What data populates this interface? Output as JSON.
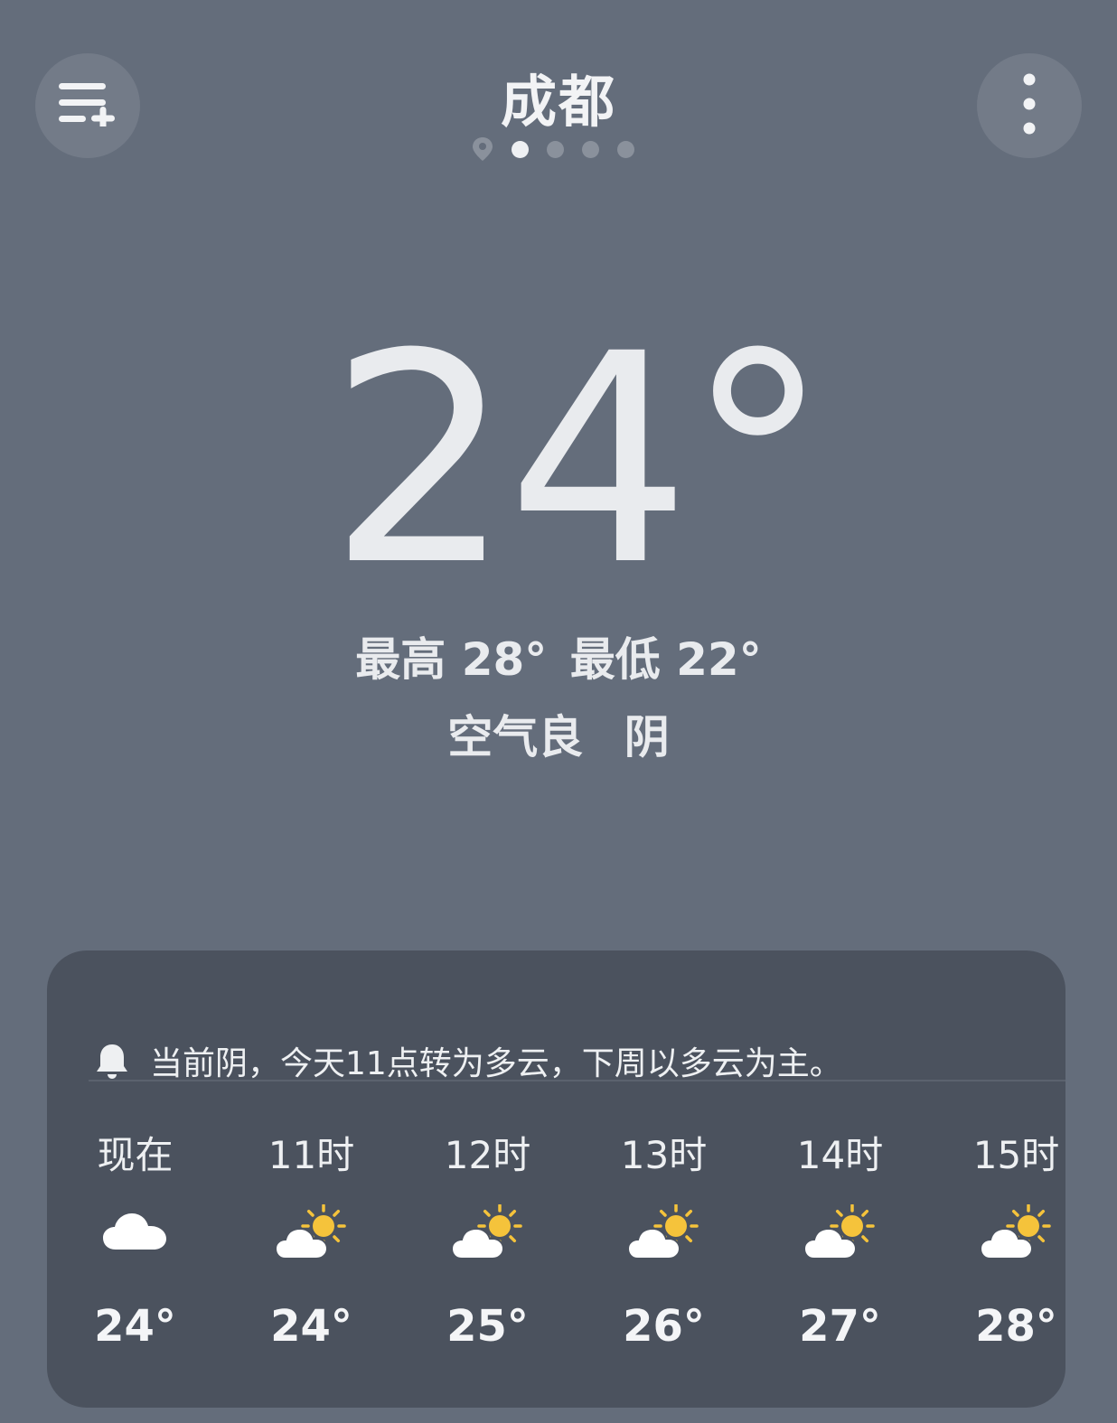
{
  "header": {
    "city": "成都",
    "menu_icon": "list-add-icon",
    "more_icon": "more-vertical-icon",
    "location_icon": "location-pin-icon",
    "page_dots": 4,
    "active_page": 1
  },
  "current": {
    "temperature": "24°",
    "high_label": "最高 28°",
    "low_label": "最低 22°",
    "air_quality": "空气良",
    "condition": "阴"
  },
  "forecast": {
    "summary": "当前阴，今天11点转为多云，下周以多云为主。",
    "summary_icon": "bell-icon",
    "hours": [
      {
        "label": "现在",
        "icon": "cloudy-icon",
        "temp": "24°"
      },
      {
        "label": "11时",
        "icon": "partly-cloudy-day-icon",
        "temp": "24°"
      },
      {
        "label": "12时",
        "icon": "partly-cloudy-day-icon",
        "temp": "25°"
      },
      {
        "label": "13时",
        "icon": "partly-cloudy-day-icon",
        "temp": "26°"
      },
      {
        "label": "14时",
        "icon": "partly-cloudy-day-icon",
        "temp": "27°"
      },
      {
        "label": "15时",
        "icon": "partly-cloudy-day-icon",
        "temp": "28°"
      }
    ]
  },
  "colors": {
    "background": "#646d7b",
    "card": "#4b525e",
    "sun": "#f5c33b",
    "text": "#e9ebee"
  }
}
